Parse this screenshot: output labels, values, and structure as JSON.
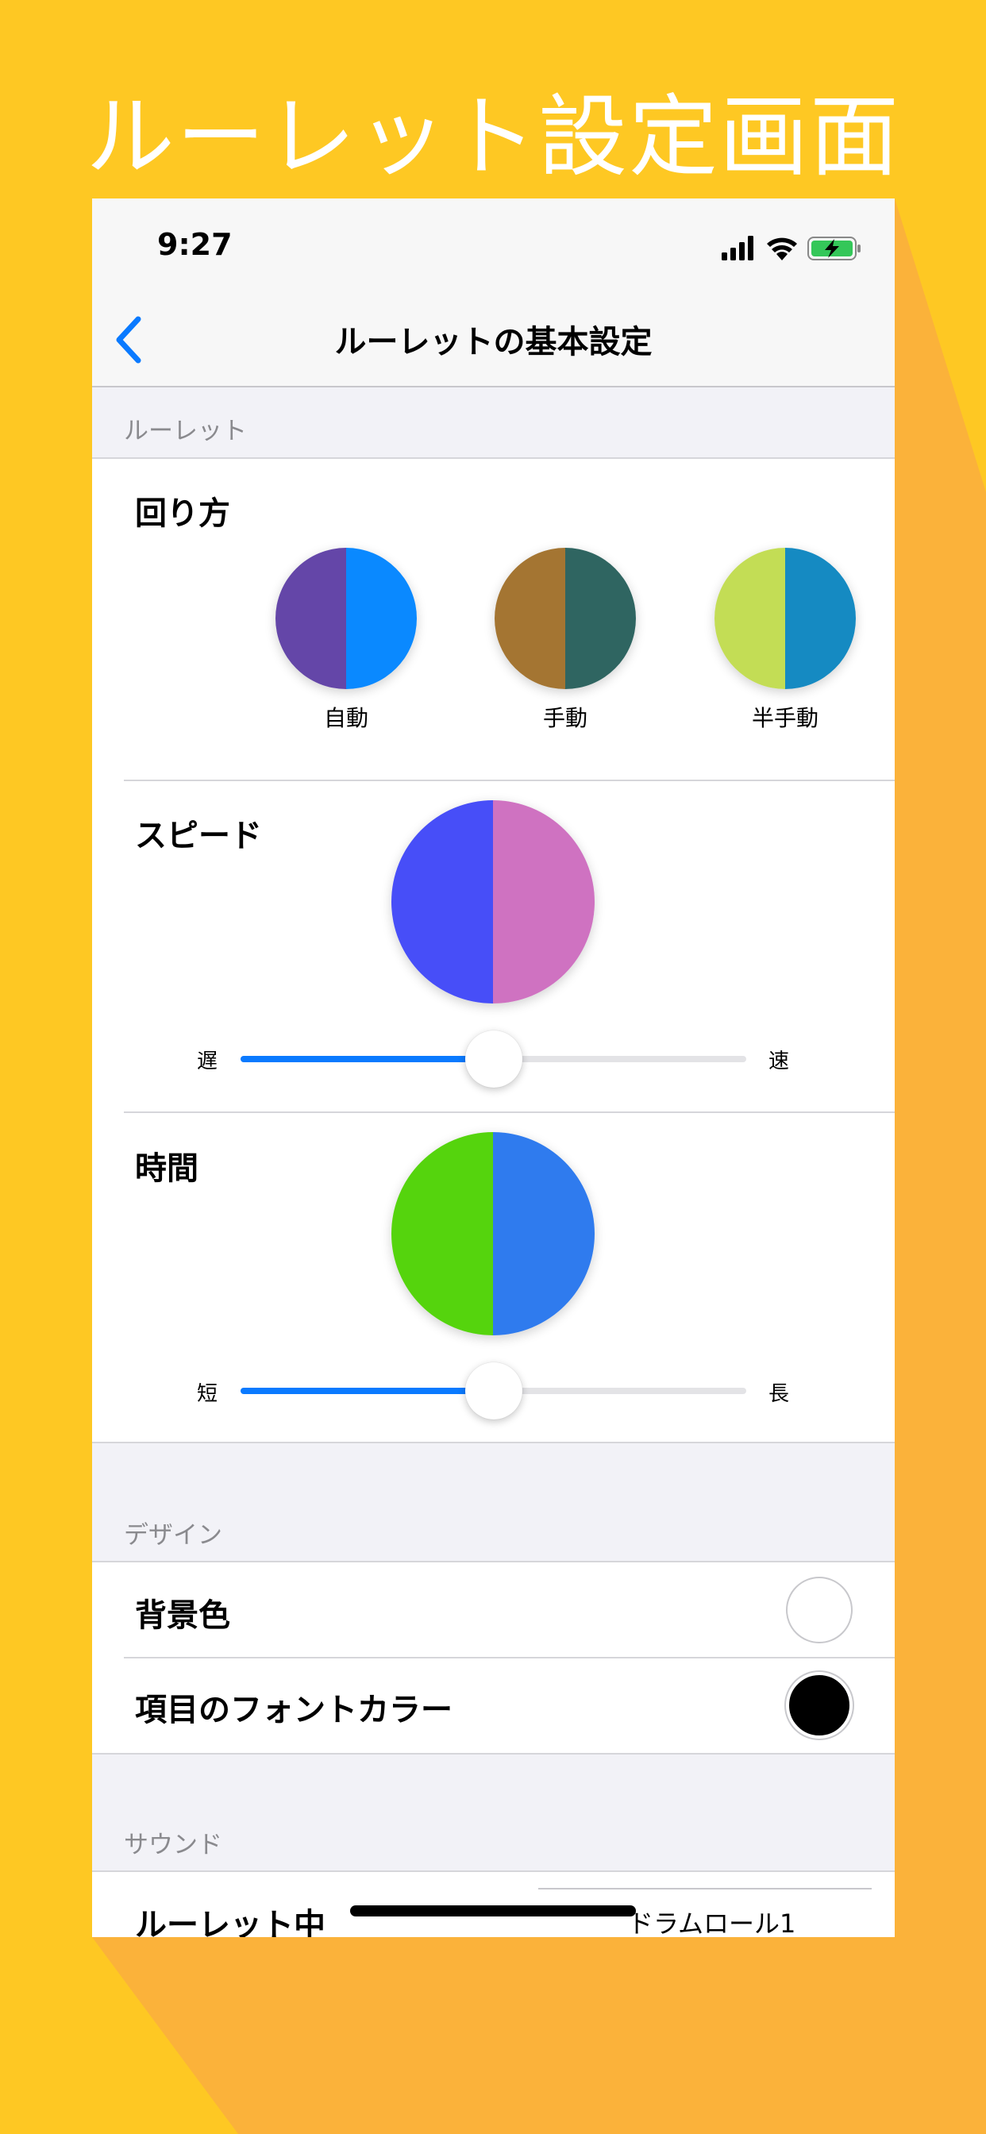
{
  "promo": {
    "title": "ルーレット設定画面"
  },
  "status_bar": {
    "time": "9:27",
    "icons": [
      "signal-icon",
      "wifi-icon",
      "battery-charging-icon"
    ]
  },
  "nav": {
    "back_icon": "chevron-left-icon",
    "title": "ルーレットの基本設定"
  },
  "sections": {
    "roulette": {
      "header": "ルーレット",
      "spin_mode": {
        "title": "回り方",
        "options": [
          {
            "label": "自動",
            "colors": [
              "#6446A8",
              "#0A89FF"
            ]
          },
          {
            "label": "手動",
            "colors": [
              "#A47532",
              "#2F6561"
            ]
          },
          {
            "label": "半手動",
            "colors": [
              "#C3DD55",
              "#158AC2"
            ]
          }
        ]
      },
      "speed": {
        "title": "スピード",
        "colors": [
          "#474EF8",
          "#CF72C1"
        ],
        "min_label": "遅",
        "max_label": "速",
        "value": 0.5
      },
      "time": {
        "title": "時間",
        "colors": [
          "#55D40D",
          "#2F7BEE"
        ],
        "min_label": "短",
        "max_label": "長",
        "value": 0.5
      }
    },
    "design": {
      "header": "デザイン",
      "rows": [
        {
          "label": "背景色",
          "swatch_color": "#FFFFFF"
        },
        {
          "label": "項目のフォントカラー",
          "swatch_color": "#000000"
        }
      ]
    },
    "sound": {
      "header": "サウンド",
      "rows": [
        {
          "label": "ルーレット中",
          "value": "ドラムロール1"
        }
      ]
    }
  },
  "colors": {
    "background": "#FEC823",
    "background_shadow": "#FBB23A",
    "accent": "#0A7AFF"
  }
}
